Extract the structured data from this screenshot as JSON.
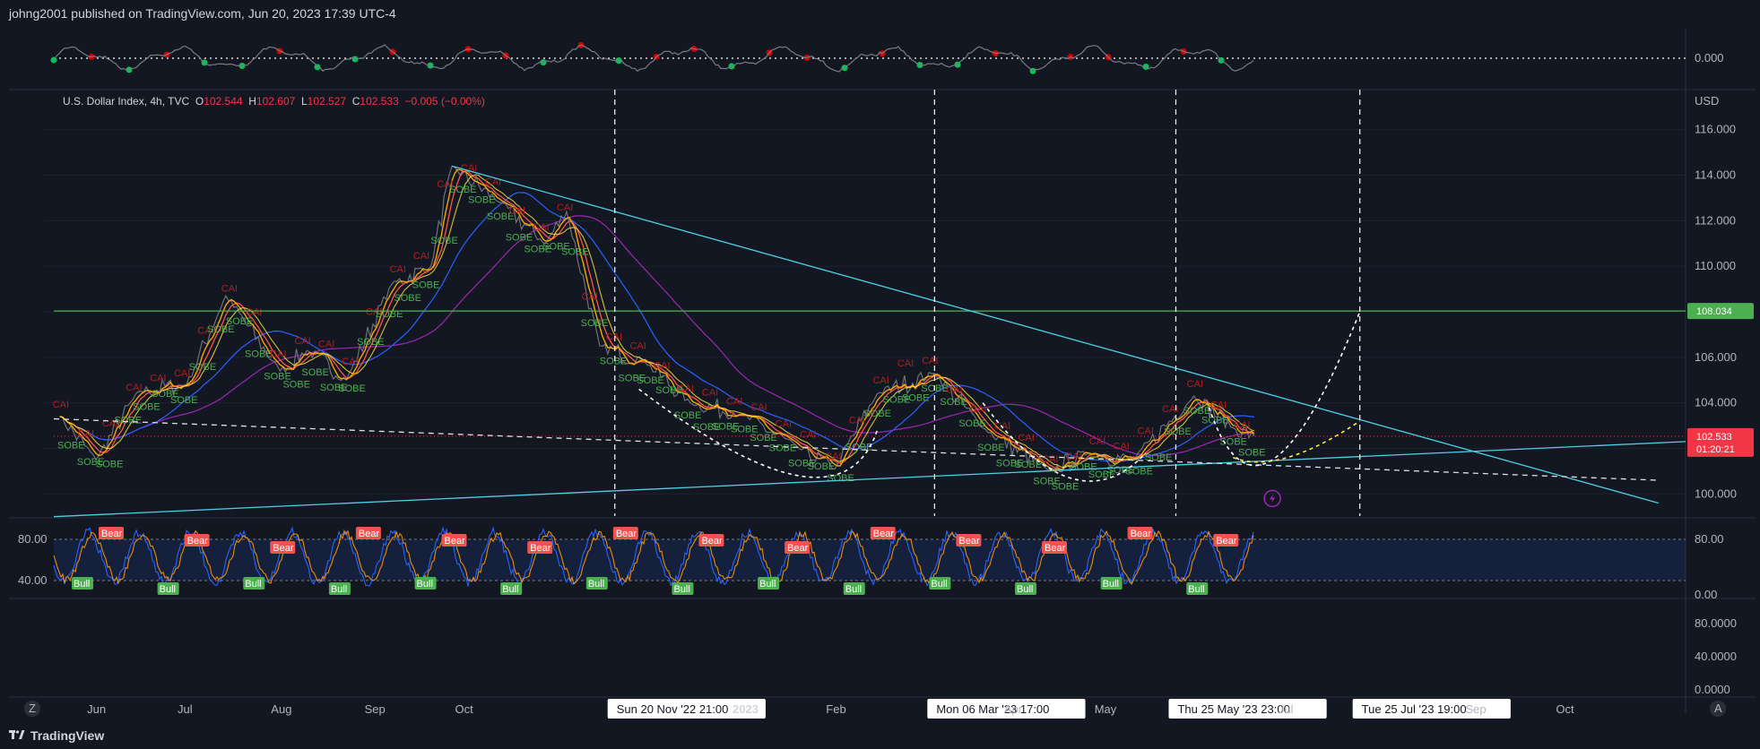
{
  "header": {
    "published": "johng2001 published on TradingView.com, Jun 20, 2023 17:39 UTC-4"
  },
  "legend": {
    "symbol": "U.S. Dollar Index, 4h, TVC",
    "o_label": "O",
    "o": "102.544",
    "h_label": "H",
    "h": "102.607",
    "l_label": "L",
    "l": "102.527",
    "c_label": "C",
    "c": "102.533",
    "change": "−0.005 (−0.00%)"
  },
  "footer": {
    "brand": "TradingView"
  },
  "corner": {
    "left": "Z",
    "right": "A"
  },
  "chart_data": {
    "type": "line",
    "instrument": "U.S. Dollar Index, 4h, TVC",
    "currency": "USD",
    "price_axis": {
      "ticks": [
        "116.000",
        "114.000",
        "112.000",
        "110.000",
        "108.000",
        "106.000",
        "104.000",
        "102.000",
        "100.000"
      ],
      "ylim": [
        99.5,
        116.5
      ]
    },
    "time_axis": {
      "labels": [
        "Jun",
        "Jul",
        "Aug",
        "Sep",
        "Oct",
        "2023",
        "Feb",
        "Apr",
        "May",
        "Jul",
        "Sep",
        "Oct"
      ]
    },
    "series": [
      {
        "x": [
          "May 20 '22",
          "Jun 1 '22",
          "Jun 15 '22",
          "Jul 1 '22",
          "Jul 14 '22",
          "Aug 1 '22",
          "Aug 10 '22",
          "Aug 23 '22",
          "Sep 7 '22",
          "Sep 20 '22",
          "Sep 27 '22",
          "Oct 13 '22",
          "Oct 28 '22",
          "Nov 4 '22",
          "Nov 15 '22",
          "Nov 30 '22",
          "Dec 15 '22",
          "Jan 1 '23",
          "Jan 20 '23",
          "Feb 1 '23",
          "Feb 15 '23",
          "Mar 6 '23",
          "Mar 22 '23",
          "Apr 13 '23",
          "Apr 26 '23",
          "May 11 '23",
          "May 31 '23",
          "Jun 13 '23",
          "Jun 20 '23"
        ],
        "values": [
          103.4,
          101.5,
          104.5,
          104.8,
          108.7,
          105.4,
          106.3,
          105.0,
          109.2,
          110.0,
          114.4,
          112.8,
          111.0,
          112.4,
          106.5,
          105.8,
          104.0,
          103.5,
          102.0,
          101.1,
          104.4,
          105.3,
          102.9,
          101.0,
          101.8,
          101.5,
          104.3,
          102.9,
          102.533
        ]
      }
    ],
    "horizontal_lines": [
      {
        "value": 108.034,
        "label": "108.034",
        "color": "#4caf50"
      }
    ],
    "last_price": {
      "value": "102.533",
      "countdown": "01:20:21"
    },
    "vertical_markers": [
      "Sun 20 Nov '22   21:00",
      "Mon 06 Mar '23   17:00",
      "Thu 25 May '23   23:00",
      "Tue 25 Jul '23   19:00"
    ],
    "oscillator_top": {
      "zero_label": "0.000"
    },
    "stochastic": {
      "left_ticks": [
        "80.00",
        "40.00"
      ],
      "right_ticks": [
        "80.00",
        "0.00"
      ],
      "bear_labels": [
        "Bear",
        "Bear",
        "Bear",
        "Bear",
        "Bear",
        "Bear",
        "Bear",
        "Bear",
        "Bear",
        "Bear",
        "Bear",
        "Bear",
        "Bear",
        "Bear"
      ],
      "bull_labels": [
        "Bull",
        "Bull",
        "Bull",
        "Bull",
        "Bull",
        "Bull",
        "Bull",
        "Bull",
        "Bull",
        "Bull",
        "Bull",
        "Bull",
        "Bull",
        "Bull"
      ]
    },
    "bottom_pane": {
      "ticks": [
        "80.0000",
        "40.0000",
        "0.0000"
      ]
    },
    "colors": {
      "bg": "#131722",
      "price_line": "#f7a600",
      "trend": "#4dd0e1",
      "green": "#4caf50",
      "red": "#f23645",
      "stoch": "#2962ff"
    }
  }
}
